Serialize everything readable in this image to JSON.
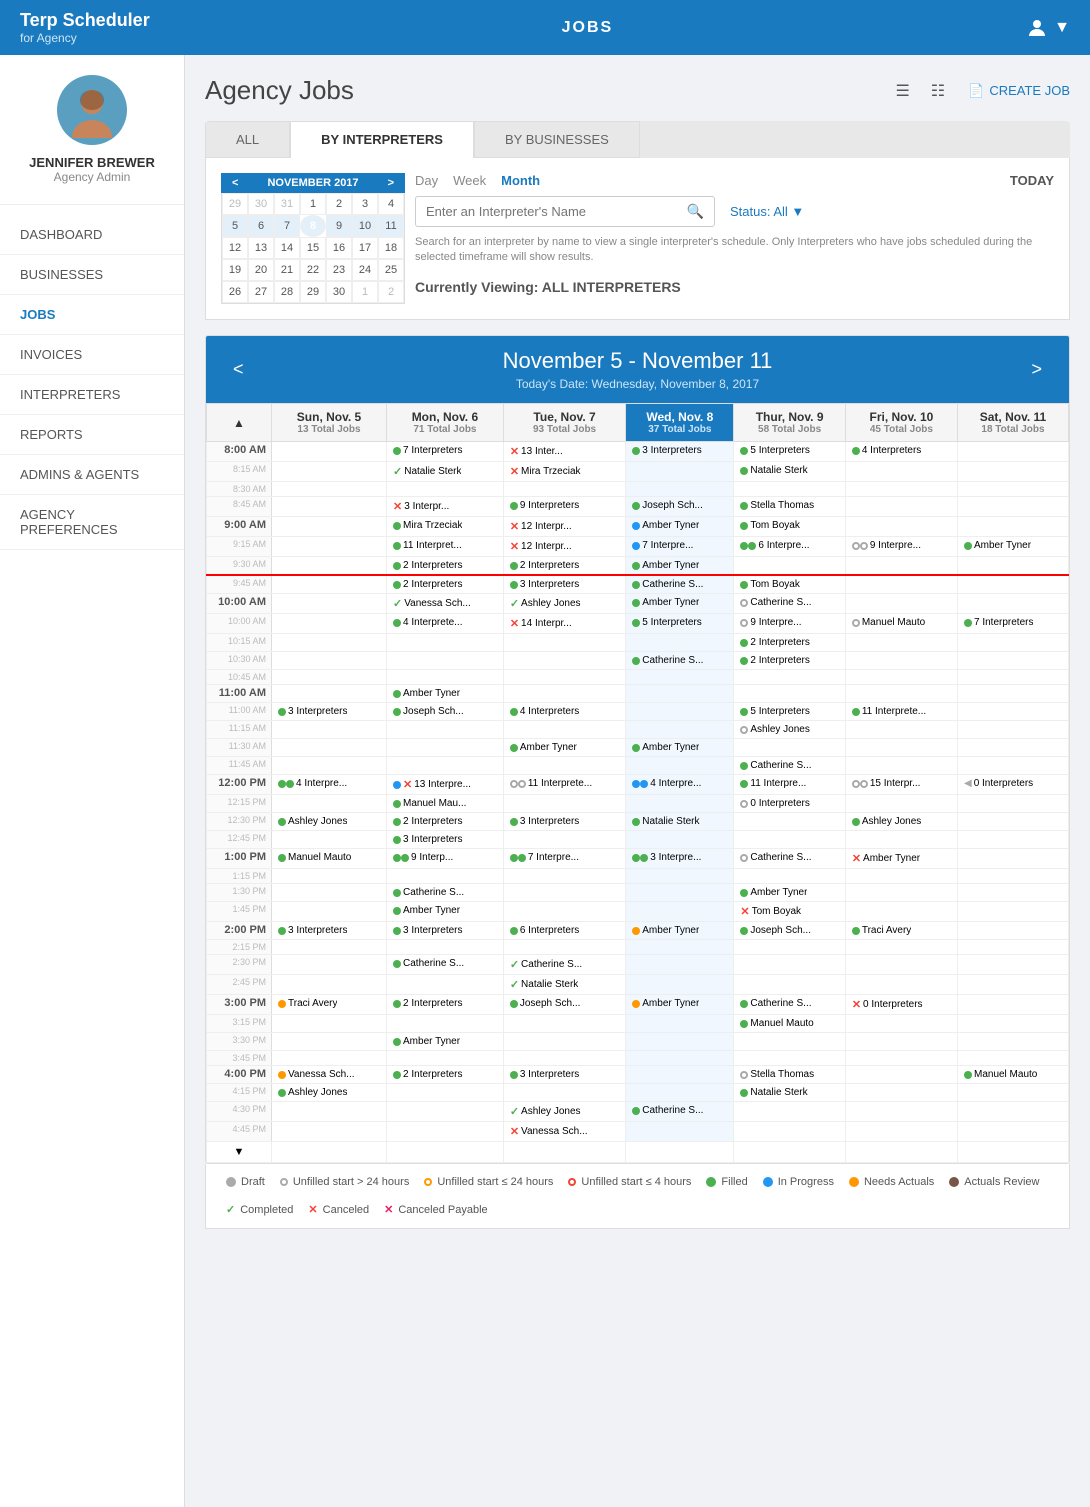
{
  "app": {
    "brand": "Terp Scheduler",
    "brand_sub": "for Agency",
    "nav_center": "JOBS",
    "user_icon": "person-icon"
  },
  "sidebar": {
    "profile_name": "JENNIFER BREWER",
    "profile_role": "Agency Admin",
    "nav_items": [
      {
        "label": "DASHBOARD",
        "active": false
      },
      {
        "label": "BUSINESSES",
        "active": false
      },
      {
        "label": "JOBS",
        "active": true
      },
      {
        "label": "INVOICES",
        "active": false
      },
      {
        "label": "INTERPRETERS",
        "active": false
      },
      {
        "label": "REPORTS",
        "active": false
      },
      {
        "label": "ADMINS & AGENTS",
        "active": false
      },
      {
        "label": "AGENCY PREFERENCES",
        "active": false
      }
    ]
  },
  "page": {
    "title": "Agency Jobs",
    "create_job_label": "CREATE JOB",
    "tabs": [
      "ALL",
      "BY INTERPRETERS",
      "BY BUSINESSES"
    ],
    "active_tab": "BY INTERPRETERS"
  },
  "calendar_mini": {
    "month_year": "NOVEMBER 2017",
    "weeks": [
      [
        "29",
        "30",
        "31",
        "1",
        "2",
        "3",
        "4"
      ],
      [
        "5",
        "6",
        "7",
        "8",
        "9",
        "10",
        "11"
      ],
      [
        "12",
        "13",
        "14",
        "15",
        "16",
        "17",
        "18"
      ],
      [
        "19",
        "20",
        "21",
        "22",
        "23",
        "24",
        "25"
      ],
      [
        "26",
        "27",
        "28",
        "29",
        "30",
        "1",
        "2"
      ]
    ],
    "today": "8",
    "selected_week_indices": [
      1
    ]
  },
  "view_controls": {
    "views": [
      "Day",
      "Week",
      "Month"
    ],
    "active_view": "Week",
    "today_label": "TODAY",
    "search_placeholder": "Enter an Interpreter's Name",
    "search_hint": "Search for an interpreter by name to view a single interpreter's schedule. Only Interpreters who have jobs scheduled during the selected timeframe will show results.",
    "status_label": "Status:",
    "status_value": "All",
    "viewing_label": "Currently Viewing: ALL INTERPRETERS"
  },
  "week_calendar": {
    "title": "November 5 - November 11",
    "subtitle": "Today's Date: Wednesday, November 8, 2017",
    "columns": [
      {
        "name": "Sun, Nov. 5",
        "total": "13 Total Jobs",
        "today": false
      },
      {
        "name": "Mon, Nov. 6",
        "total": "71 Total Jobs",
        "today": false
      },
      {
        "name": "Tue, Nov. 7",
        "total": "93 Total Jobs",
        "today": false
      },
      {
        "name": "Wed, Nov. 8",
        "total": "37 Total Jobs",
        "today": true
      },
      {
        "name": "Thur, Nov. 9",
        "total": "58 Total Jobs",
        "today": false
      },
      {
        "name": "Fri, Nov. 10",
        "total": "45 Total Jobs",
        "today": false
      },
      {
        "name": "Sat, Nov. 11",
        "total": "18 Total Jobs",
        "today": false
      }
    ],
    "rows": [
      {
        "time": "8:00 AM",
        "hour": true,
        "current_time": false,
        "cells": [
          "",
          {
            "type": "filled",
            "text": "7 Interpreters"
          },
          {
            "type": "canceled",
            "dot_type": "canceled",
            "text": "13 Inter..."
          },
          {
            "type": "filled",
            "text": "3 Interpreters"
          },
          {
            "type": "filled",
            "text": "5 Interpreters"
          },
          {
            "type": "filled",
            "text": "4 Interpreters"
          },
          ""
        ]
      },
      {
        "time": "8:15 AM",
        "hour": false,
        "cells": [
          "",
          {
            "type": "completed",
            "text": "Natalie Sterk"
          },
          {
            "type": "canceled",
            "text": "Mira Trzeciak"
          },
          "",
          {
            "type": "filled",
            "text": "Natalie Sterk"
          },
          "",
          ""
        ]
      },
      {
        "time": "8:30 AM",
        "hour": false,
        "cells": [
          "",
          "",
          "",
          "",
          "",
          "",
          ""
        ]
      },
      {
        "time": "8:45 AM",
        "hour": false,
        "cells": [
          "",
          {
            "type": "canceled",
            "text": "3 Interpr..."
          },
          {
            "type": "filled",
            "text": "9 Interpreters"
          },
          {
            "type": "filled",
            "text": "Joseph Sch..."
          },
          {
            "type": "filled",
            "text": "Stella Thomas"
          },
          "",
          ""
        ]
      },
      {
        "time": "9:00 AM",
        "hour": true,
        "cells": [
          "",
          {
            "type": "filled",
            "text": "Mira Trzeciak"
          },
          {
            "type": "canceled",
            "text": "12 Interpr..."
          },
          {
            "type": "inprogress",
            "text": "Amber Tyner"
          },
          {
            "type": "filled",
            "text": "Tom Boyak"
          },
          "",
          ""
        ]
      },
      {
        "time": "9:15 AM",
        "hour": false,
        "cells": [
          "",
          {
            "type": "filled",
            "text": "11 Interpret..."
          },
          {
            "type": "canceled",
            "text": "12 Interpr..."
          },
          {
            "type": "inprogress",
            "text": "7 Interpre..."
          },
          {
            "type": "filled",
            "dot2": true,
            "text": "6 Interpre..."
          },
          {
            "type": "unfilled24",
            "dot2": true,
            "text": "9 Interpre..."
          },
          {
            "type": "filled",
            "text": "Amber Tyner"
          }
        ]
      },
      {
        "time": "9:30 AM",
        "hour": false,
        "cells": [
          "",
          {
            "type": "filled",
            "text": "2 Interpreters"
          },
          {
            "type": "filled",
            "text": "2 Interpreters"
          },
          {
            "type": "filled",
            "text": "Amber Tyner"
          },
          "",
          "",
          ""
        ]
      },
      {
        "time": "9:45 AM",
        "hour": false,
        "current_time": true,
        "cells": [
          "",
          {
            "type": "filled",
            "text": "2 Interpreters"
          },
          {
            "type": "filled",
            "text": "3 Interpreters"
          },
          {
            "type": "filled",
            "text": "Catherine S..."
          },
          {
            "type": "filled",
            "text": "Tom Boyak"
          },
          "",
          ""
        ]
      },
      {
        "time": "10:00 AM",
        "hour": true,
        "cells": [
          "",
          {
            "type": "completed",
            "text": "Vanessa Sch..."
          },
          {
            "type": "completed",
            "text": "Ashley Jones"
          },
          {
            "type": "filled",
            "text": "Amber Tyner"
          },
          {
            "type": "unfilled24",
            "text": "Catherine S..."
          },
          "",
          ""
        ]
      },
      {
        "time": "10:00 AM",
        "hour": false,
        "cells": [
          "",
          {
            "type": "filled",
            "text": "4 Interprete..."
          },
          {
            "type": "canceled",
            "text": "14 Interpr..."
          },
          {
            "type": "filled",
            "text": "5 Interpreters"
          },
          {
            "type": "unfilled24",
            "text": "9 Interpre..."
          },
          {
            "type": "unfilled24",
            "text": "Manuel Mauto"
          },
          {
            "type": "filled",
            "text": "7 Interpreters"
          }
        ]
      },
      {
        "time": "10:15 AM",
        "hour": false,
        "cells": [
          "",
          "",
          "",
          "",
          {
            "type": "filled",
            "text": "2 Interpreters"
          },
          "",
          ""
        ]
      },
      {
        "time": "10:30 AM",
        "hour": false,
        "cells": [
          "",
          "",
          "",
          {
            "type": "filled",
            "text": "Catherine S..."
          },
          {
            "type": "filled",
            "text": "2 Interpreters"
          },
          "",
          ""
        ]
      },
      {
        "time": "10:45 AM",
        "hour": false,
        "cells": [
          "",
          "",
          "",
          "",
          "",
          "",
          ""
        ]
      },
      {
        "time": "11:00 AM",
        "hour": true,
        "cells": [
          "",
          {
            "type": "filled",
            "text": "Amber Tyner"
          },
          "",
          "",
          "",
          "",
          ""
        ]
      },
      {
        "time": "11:00 AM",
        "hour": false,
        "cells": [
          {
            "type": "filled",
            "text": "3 Interpreters"
          },
          {
            "type": "filled",
            "text": "Joseph Sch..."
          },
          {
            "type": "filled",
            "text": "4 Interpreters"
          },
          "",
          {
            "type": "filled",
            "text": "5 Interpreters"
          },
          {
            "type": "filled",
            "text": "11 Interprete..."
          },
          ""
        ]
      },
      {
        "time": "11:15 AM",
        "hour": false,
        "cells": [
          "",
          "",
          "",
          "",
          {
            "type": "unfilled24",
            "text": "Ashley Jones"
          },
          "",
          ""
        ]
      },
      {
        "time": "11:30 AM",
        "hour": false,
        "cells": [
          "",
          "",
          {
            "type": "filled",
            "text": "Amber Tyner"
          },
          {
            "type": "filled",
            "text": "Amber Tyner"
          },
          "",
          "",
          ""
        ]
      },
      {
        "time": "11:45 AM",
        "hour": false,
        "cells": [
          "",
          "",
          "",
          "",
          {
            "type": "filled",
            "text": "Catherine S..."
          },
          "",
          ""
        ]
      },
      {
        "time": "12:00 PM",
        "hour": true,
        "cells": [
          {
            "type": "filled",
            "dot2": true,
            "text": "4 Interpre..."
          },
          {
            "type": "canceled",
            "dot2": true,
            "text": "13 Interpre..."
          },
          {
            "type": "unfilled24",
            "dot2": true,
            "text": "11 Interprete..."
          },
          {
            "type": "inprogress",
            "dot2": true,
            "text": "4 Interpre..."
          },
          {
            "type": "filled",
            "text": "11 Interpre..."
          },
          {
            "type": "unfilled24",
            "dot2": true,
            "text": "15 Interpr..."
          },
          {
            "type": "draft",
            "text": "0 Interpreters"
          }
        ]
      },
      {
        "time": "12:15 PM",
        "hour": false,
        "cells": [
          "",
          {
            "type": "filled",
            "text": "Manuel Mau..."
          },
          "",
          "",
          {
            "type": "unfilled24",
            "text": "0 Interpreters"
          },
          "",
          ""
        ]
      },
      {
        "time": "12:30 PM",
        "hour": false,
        "cells": [
          {
            "type": "filled",
            "text": "Ashley Jones"
          },
          {
            "type": "filled",
            "text": "2 Interpreters"
          },
          {
            "type": "filled",
            "text": "3 Interpreters"
          },
          {
            "type": "filled",
            "text": "Natalie Sterk"
          },
          "",
          {
            "type": "filled",
            "text": "Ashley Jones"
          },
          ""
        ]
      },
      {
        "time": "12:45 PM",
        "hour": false,
        "cells": [
          "",
          {
            "type": "filled",
            "text": "3 Interpreters"
          },
          "",
          "",
          "",
          "",
          ""
        ]
      },
      {
        "time": "1:00 PM",
        "hour": true,
        "cells": [
          {
            "type": "filled",
            "text": "Manuel Mauto"
          },
          {
            "type": "filled",
            "dot2": true,
            "canceled": true,
            "text": "9 Interp..."
          },
          {
            "type": "filled",
            "dot2": true,
            "text": "7 Interpre..."
          },
          {
            "type": "filled",
            "dot2": true,
            "text": "3 Interpre..."
          },
          {
            "type": "unfilled24",
            "text": "Catherine S..."
          },
          {
            "type": "canceled",
            "text": "Amber Tyner"
          },
          ""
        ]
      },
      {
        "time": "1:15 PM",
        "hour": false,
        "cells": [
          "",
          "",
          "",
          "",
          "",
          "",
          ""
        ]
      },
      {
        "time": "1:30 PM",
        "hour": false,
        "cells": [
          "",
          {
            "type": "filled",
            "text": "Catherine S..."
          },
          "",
          "",
          {
            "type": "filled",
            "text": "Amber Tyner"
          },
          "",
          ""
        ]
      },
      {
        "time": "1:45 PM",
        "hour": false,
        "cells": [
          "",
          {
            "type": "filled",
            "text": "Amber Tyner"
          },
          "",
          "",
          {
            "type": "canceled",
            "text": "Tom Boyak"
          },
          "",
          ""
        ]
      },
      {
        "time": "2:00 PM",
        "hour": true,
        "cells": [
          {
            "type": "filled",
            "text": "3 Interpreters"
          },
          {
            "type": "filled",
            "text": "3 Interpreters"
          },
          {
            "type": "filled",
            "text": "6 Interpreters"
          },
          {
            "type": "needs-actuals",
            "text": "Amber Tyner"
          },
          {
            "type": "filled",
            "text": "Joseph Sch..."
          },
          {
            "type": "filled",
            "text": "Traci Avery"
          },
          ""
        ]
      },
      {
        "time": "2:15 PM",
        "hour": false,
        "cells": [
          "",
          "",
          "",
          "",
          "",
          "",
          ""
        ]
      },
      {
        "time": "2:30 PM",
        "hour": false,
        "cells": [
          "",
          {
            "type": "filled",
            "text": "Catherine S..."
          },
          {
            "type": "completed",
            "text": "Catherine S..."
          },
          "",
          "",
          "",
          ""
        ]
      },
      {
        "time": "2:45 PM",
        "hour": false,
        "cells": [
          "",
          "",
          {
            "type": "completed",
            "text": "Natalie Sterk"
          },
          "",
          "",
          "",
          ""
        ]
      },
      {
        "time": "3:00 PM",
        "hour": true,
        "cells": [
          {
            "type": "needs-actuals",
            "text": "Traci Avery"
          },
          {
            "type": "filled",
            "text": "2 Interpreters"
          },
          {
            "type": "filled",
            "text": "Joseph Sch..."
          },
          {
            "type": "needs-actuals",
            "text": "Amber Tyner"
          },
          {
            "type": "filled",
            "text": "Catherine S..."
          },
          {
            "type": "canceled",
            "text": "0 Interpreters"
          },
          ""
        ]
      },
      {
        "time": "3:15 PM",
        "hour": false,
        "cells": [
          "",
          "",
          "",
          "",
          {
            "type": "filled",
            "text": "Manuel Mauto"
          },
          "",
          ""
        ]
      },
      {
        "time": "3:30 PM",
        "hour": false,
        "cells": [
          "",
          {
            "type": "filled",
            "text": "Amber Tyner"
          },
          "",
          "",
          "",
          "",
          ""
        ]
      },
      {
        "time": "3:45 PM",
        "hour": false,
        "cells": [
          "",
          "",
          "",
          "",
          "",
          "",
          ""
        ]
      },
      {
        "time": "4:00 PM",
        "hour": true,
        "cells": [
          {
            "type": "needs-actuals",
            "text": "Vanessa Sch..."
          },
          {
            "type": "filled",
            "text": "2 Interpreters"
          },
          {
            "type": "filled",
            "text": "3 Interpreters"
          },
          "",
          {
            "type": "unfilled24",
            "text": "Stella Thomas"
          },
          "",
          {
            "type": "filled",
            "text": "Manuel Mauto"
          }
        ]
      },
      {
        "time": "4:15 PM",
        "hour": false,
        "cells": [
          {
            "type": "filled",
            "text": "Ashley Jones"
          },
          "",
          "",
          "",
          {
            "type": "filled",
            "text": "Natalie Sterk"
          },
          "",
          ""
        ]
      },
      {
        "time": "4:30 PM",
        "hour": false,
        "cells": [
          "",
          "",
          {
            "type": "completed",
            "text": "Ashley Jones"
          },
          {
            "type": "filled",
            "text": "Catherine S..."
          },
          "",
          "",
          ""
        ]
      },
      {
        "time": "4:45 PM",
        "hour": false,
        "cells": [
          "",
          "",
          {
            "type": "canceled",
            "text": "Vanessa Sch..."
          },
          "",
          "",
          "",
          ""
        ]
      }
    ]
  },
  "legend": [
    {
      "type": "draft",
      "label": "Draft"
    },
    {
      "type": "unfilled24",
      "label": "Unfilled start > 24 hours"
    },
    {
      "type": "unfilled_lt24",
      "label": "Unfilled start ≤ 24 hours"
    },
    {
      "type": "unfilled_lt4",
      "label": "Unfilled start ≤ 4 hours"
    },
    {
      "type": "filled",
      "label": "Filled"
    },
    {
      "type": "inprogress",
      "label": "In Progress"
    },
    {
      "type": "needs_actuals",
      "label": "Needs Actuals"
    },
    {
      "type": "actuals_review",
      "label": "Actuals Review"
    },
    {
      "type": "completed",
      "label": "Completed"
    },
    {
      "type": "canceled",
      "label": "Canceled"
    },
    {
      "type": "canceled_payable",
      "label": "Canceled Payable"
    }
  ]
}
